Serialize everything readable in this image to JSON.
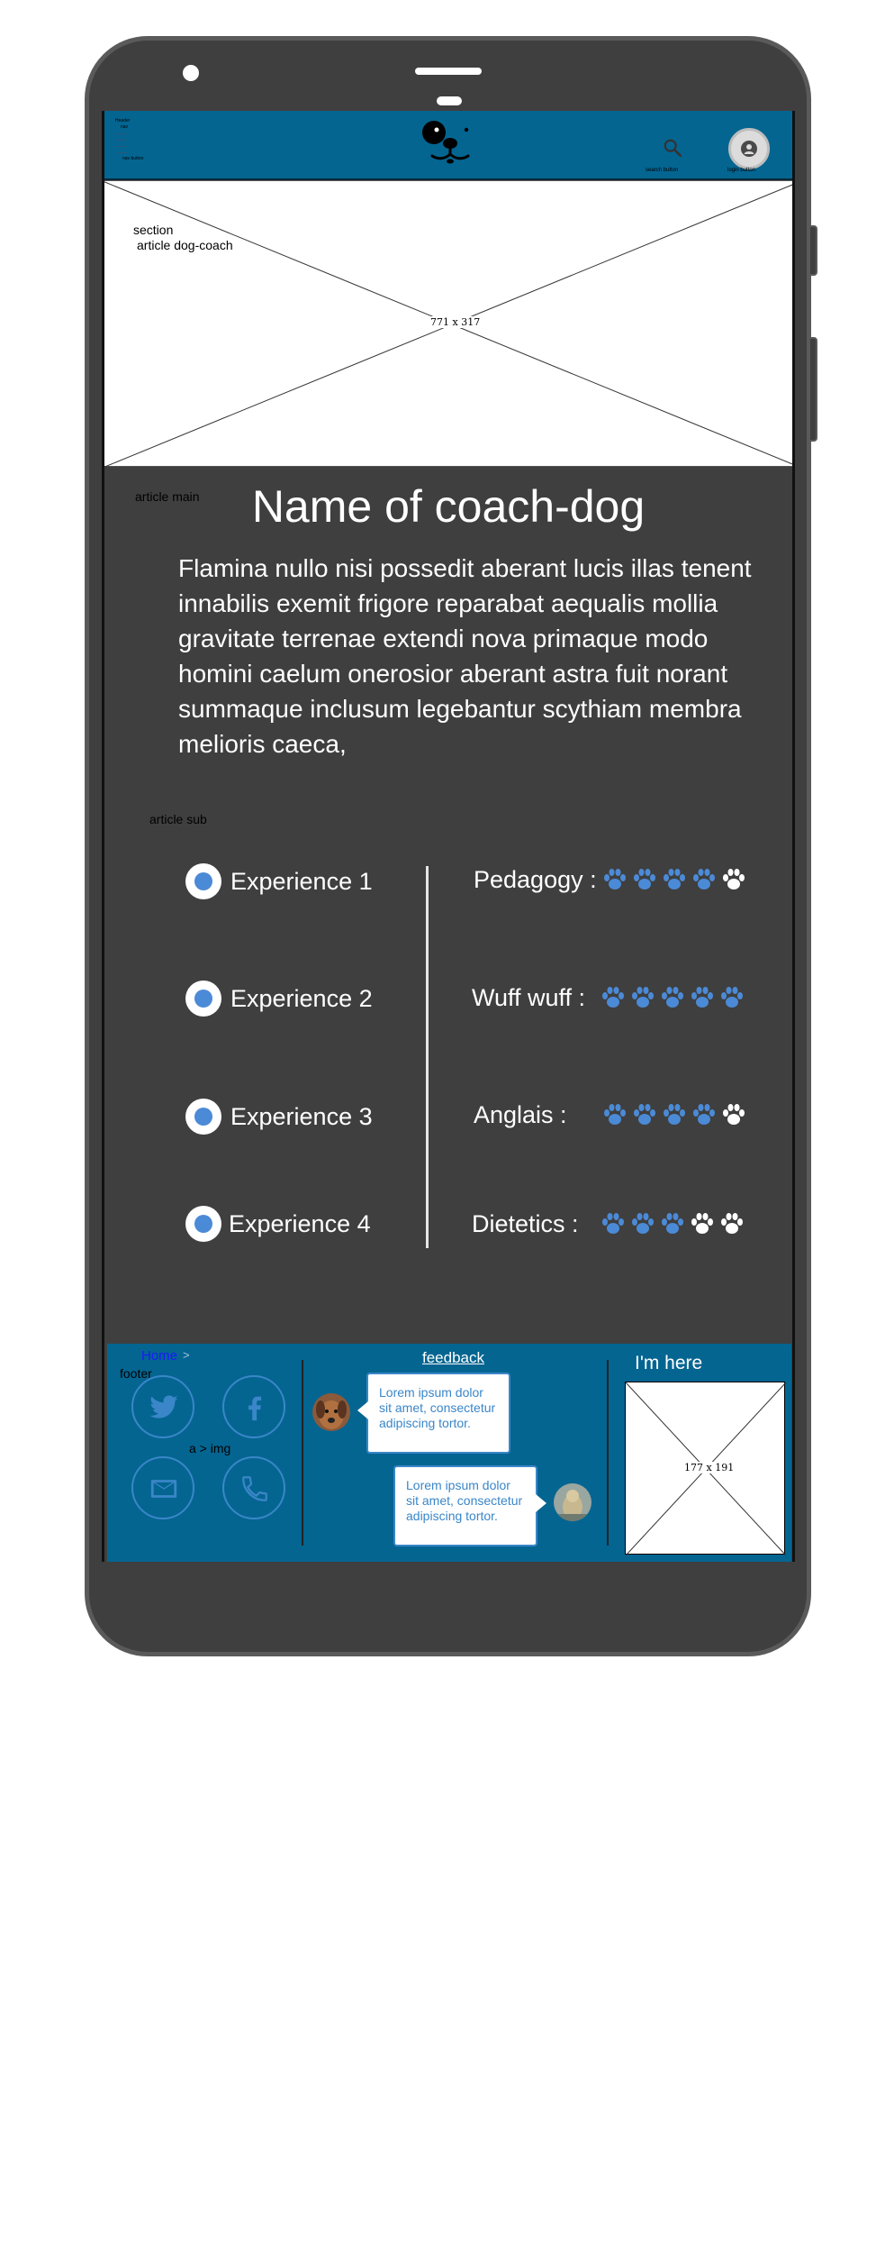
{
  "header": {
    "nav_lines": [
      "Header",
      "nav",
      "..........",
      "..........",
      "..........",
      "..........",
      "nav button"
    ],
    "search_label": "search button",
    "account_label": "login button"
  },
  "hero": {
    "label_line1": "section",
    "label_line2": "article dog-coach",
    "size": "771 x 317"
  },
  "main": {
    "section_label": "article main",
    "title": "Name of coach-dog",
    "description": "Flamina nullo nisi possedit aberant lucis illas tenent innabilis exemit frigore reparabat aequalis mollia gravitate terrenae extendi nova primaque modo homini caelum onerosior aberant astra fuit norant summaque inclusum legebantur scythiam membra melioris caeca,"
  },
  "sub": {
    "section_label": "article sub",
    "experiences": [
      "Experience 1",
      "Experience 2",
      "Experience 3",
      "Experience 4"
    ],
    "skills": [
      {
        "name": "Pedagogy :",
        "rating": 4,
        "max": 5
      },
      {
        "name": "Wuff wuff :",
        "rating": 5,
        "max": 5
      },
      {
        "name": "Anglais :",
        "rating": 4,
        "max": 5
      },
      {
        "name": "Dietetics :",
        "rating": 3,
        "max": 5
      }
    ]
  },
  "footer": {
    "home_link": "Home",
    "home_sep": ">",
    "label": "footer",
    "social_caption": "a > img",
    "social_icons": [
      "twitter-icon",
      "facebook-icon",
      "mail-icon",
      "phone-icon"
    ],
    "feedback_title": "feedback",
    "bubbles": [
      "Lorem ipsum dolor sit amet, consectetur adipiscing tortor.",
      "Lorem ipsum dolor sit amet, consectetur adipiscing tortor."
    ],
    "map_title": "I'm here",
    "map_size": "177 x 191"
  },
  "colors": {
    "header_bg": "#046591",
    "phone_body": "#3f3f3f",
    "paw_active": "#4b8ad6",
    "paw_inactive": "#ffffff"
  }
}
